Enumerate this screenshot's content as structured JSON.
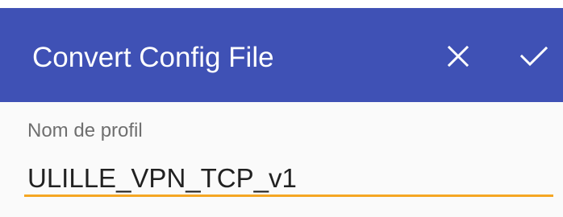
{
  "app_bar": {
    "title": "Convert Config File",
    "close_icon": "close-icon",
    "confirm_icon": "check-icon",
    "color": "#3f51b5"
  },
  "form": {
    "profile_name_label": "Nom de profil",
    "profile_name_value": "ULILLE_VPN_TCP_v1",
    "accent_color": "#f5a623"
  }
}
